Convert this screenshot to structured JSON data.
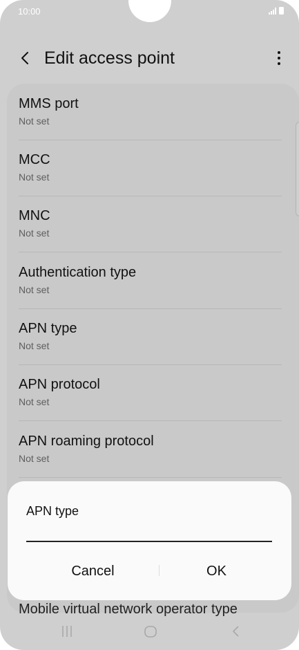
{
  "status_bar": {
    "time": "10:00",
    "icons": [
      "signal-icon",
      "battery-icon"
    ]
  },
  "header": {
    "title": "Edit access point",
    "back_icon": "back-arrow-icon",
    "more_icon": "more-options-icon"
  },
  "settings": [
    {
      "label": "MMS port",
      "value": "Not set"
    },
    {
      "label": "MCC",
      "value": "Not set"
    },
    {
      "label": "MNC",
      "value": "Not set"
    },
    {
      "label": "Authentication type",
      "value": "Not set"
    },
    {
      "label": "APN type",
      "value": "Not set"
    },
    {
      "label": "APN protocol",
      "value": "Not set"
    },
    {
      "label": "APN roaming protocol",
      "value": "Not set"
    }
  ],
  "partially_visible_row": "Mobile virtual network operator type",
  "dialog": {
    "title": "APN type",
    "input_value": "",
    "cancel_label": "Cancel",
    "ok_label": "OK"
  },
  "nav_bar": {
    "icons": [
      "recent-apps-icon",
      "home-icon",
      "back-icon"
    ]
  },
  "colors": {
    "background": "#cfcfcf",
    "dialog": "#fafafa",
    "text": "#111111",
    "secondary_text": "#5e5e5e"
  }
}
